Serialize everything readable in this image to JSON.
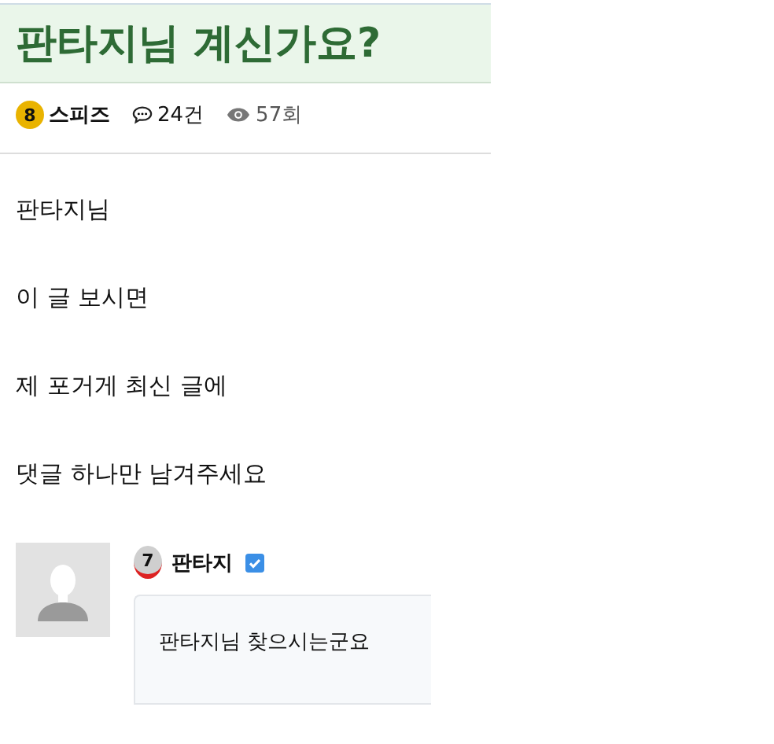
{
  "post": {
    "title": "판타지님 계신가요?",
    "author": {
      "level": "8",
      "name": "스피즈"
    },
    "comments_count": "24건",
    "views": "57회"
  },
  "body": [
    "판타지님",
    "이 글 보시면",
    "제 포거게 최신 글에",
    "댓글 하나만 남겨주세요"
  ],
  "comments": [
    {
      "level": "7",
      "name": "판타지",
      "verified": true,
      "text": "판타지님 찾으시는군요"
    }
  ]
}
